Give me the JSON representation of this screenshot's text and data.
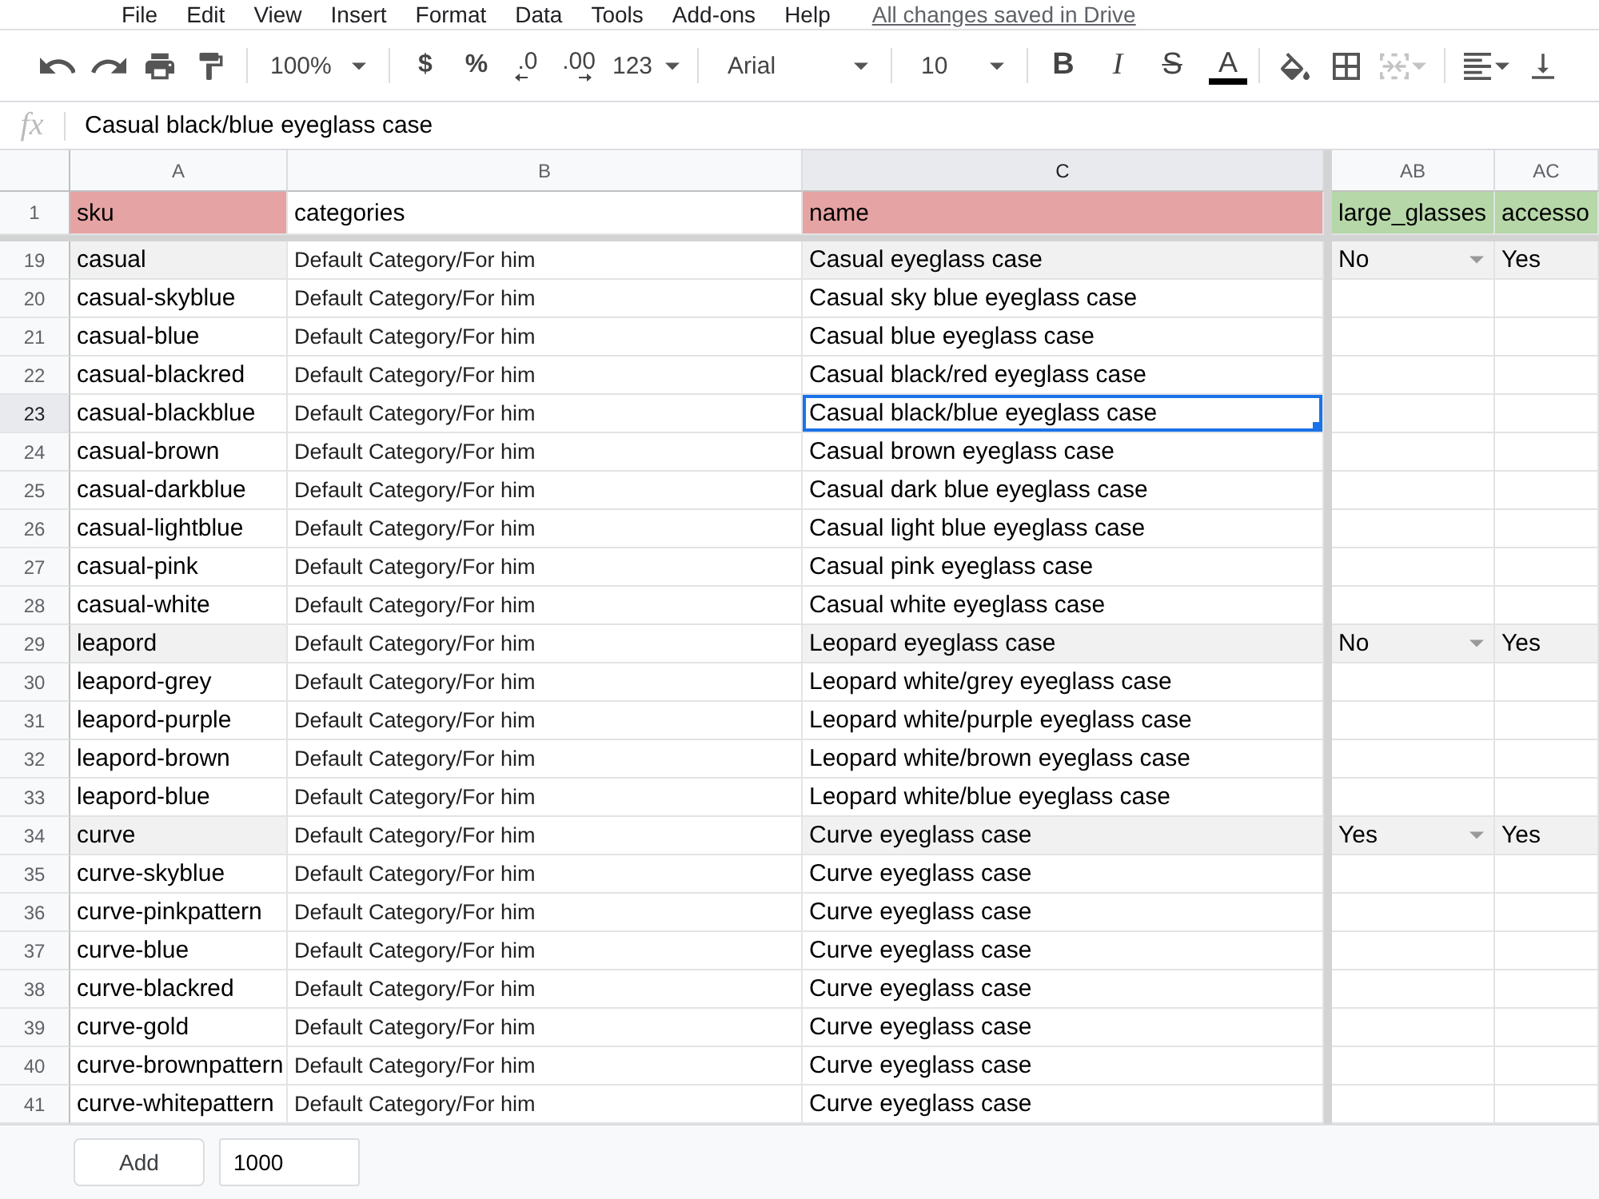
{
  "menu": {
    "items": [
      "File",
      "Edit",
      "View",
      "Insert",
      "Format",
      "Data",
      "Tools",
      "Add-ons",
      "Help"
    ],
    "save_status": "All changes saved in Drive"
  },
  "toolbar": {
    "zoom": "100%",
    "currency": "$",
    "percent": "%",
    "decrease_decimals": ".0",
    "increase_decimals": ".00",
    "number_format": "123",
    "font": "Arial",
    "font_size": "10",
    "bold": "B",
    "italic": "I",
    "strikethrough": "S",
    "text_color": "A",
    "merge_disabled": true
  },
  "formula_bar": {
    "label": "fx",
    "value": "Casual black/blue eyeglass case"
  },
  "columns": [
    {
      "letter": "A",
      "selected": false
    },
    {
      "letter": "B",
      "selected": false
    },
    {
      "letter": "C",
      "selected": true
    },
    {
      "letter": "AB",
      "selected": false
    },
    {
      "letter": "AC",
      "selected": false
    }
  ],
  "header_row": {
    "number": "1",
    "cells": [
      {
        "text": "sku",
        "color": "#e6a3a3"
      },
      {
        "text": "categories",
        "color": "#ffffff"
      },
      {
        "text": "name",
        "color": "#e6a3a3"
      },
      {
        "text": "large_glasses",
        "color": "#b6d7a8"
      },
      {
        "text": "accesso",
        "color": "#b6d7a8"
      }
    ]
  },
  "rows": [
    {
      "number": "19",
      "selected": false,
      "highlighted": true,
      "sku": "casual",
      "categories": "Default Category/For him",
      "name": "Casual eyeglass case",
      "large_glasses": "No",
      "column_ac": "Yes"
    },
    {
      "number": "20",
      "selected": false,
      "highlighted": false,
      "sku": "casual-skyblue",
      "categories": "Default Category/For him",
      "name": "Casual sky blue eyeglass case"
    },
    {
      "number": "21",
      "selected": false,
      "highlighted": false,
      "sku": "casual-blue",
      "categories": "Default Category/For him",
      "name": "Casual blue eyeglass case"
    },
    {
      "number": "22",
      "selected": false,
      "highlighted": false,
      "sku": "casual-blackred",
      "categories": "Default Category/For him",
      "name": "Casual black/red eyeglass case"
    },
    {
      "number": "23",
      "selected": true,
      "highlighted": false,
      "sku": "casual-blackblue",
      "categories": "Default Category/For him",
      "name": "Casual black/blue eyeglass case"
    },
    {
      "number": "24",
      "selected": false,
      "highlighted": false,
      "sku": "casual-brown",
      "categories": "Default Category/For him",
      "name": "Casual brown eyeglass case"
    },
    {
      "number": "25",
      "selected": false,
      "highlighted": false,
      "sku": "casual-darkblue",
      "categories": "Default Category/For him",
      "name": "Casual dark blue eyeglass case"
    },
    {
      "number": "26",
      "selected": false,
      "highlighted": false,
      "sku": "casual-lightblue",
      "categories": "Default Category/For him",
      "name": "Casual light blue eyeglass case"
    },
    {
      "number": "27",
      "selected": false,
      "highlighted": false,
      "sku": "casual-pink",
      "categories": "Default Category/For him",
      "name": "Casual pink eyeglass case"
    },
    {
      "number": "28",
      "selected": false,
      "highlighted": false,
      "sku": "casual-white",
      "categories": "Default Category/For him",
      "name": "Casual white eyeglass case"
    },
    {
      "number": "29",
      "selected": false,
      "highlighted": true,
      "sku": "leapord",
      "categories": "Default Category/For him",
      "name": "Leopard eyeglass case",
      "large_glasses": "No",
      "column_ac": "Yes"
    },
    {
      "number": "30",
      "selected": false,
      "highlighted": false,
      "sku": "leapord-grey",
      "categories": "Default Category/For him",
      "name": "Leopard white/grey eyeglass case"
    },
    {
      "number": "31",
      "selected": false,
      "highlighted": false,
      "sku": "leapord-purple",
      "categories": "Default Category/For him",
      "name": "Leopard white/purple eyeglass case"
    },
    {
      "number": "32",
      "selected": false,
      "highlighted": false,
      "sku": "leapord-brown",
      "categories": "Default Category/For him",
      "name": "Leopard white/brown eyeglass case"
    },
    {
      "number": "33",
      "selected": false,
      "highlighted": false,
      "sku": "leapord-blue",
      "categories": "Default Category/For him",
      "name": "Leopard white/blue eyeglass case"
    },
    {
      "number": "34",
      "selected": false,
      "highlighted": true,
      "sku": "curve",
      "categories": "Default Category/For him",
      "name": "Curve eyeglass case",
      "large_glasses": "Yes",
      "column_ac": "Yes"
    },
    {
      "number": "35",
      "selected": false,
      "highlighted": false,
      "sku": "curve-skyblue",
      "categories": "Default Category/For him",
      "name": "Curve eyeglass case"
    },
    {
      "number": "36",
      "selected": false,
      "highlighted": false,
      "sku": "curve-pinkpattern",
      "categories": "Default Category/For him",
      "name": "Curve eyeglass case"
    },
    {
      "number": "37",
      "selected": false,
      "highlighted": false,
      "sku": "curve-blue",
      "categories": "Default Category/For him",
      "name": "Curve eyeglass case"
    },
    {
      "number": "38",
      "selected": false,
      "highlighted": false,
      "sku": "curve-blackred",
      "categories": "Default Category/For him",
      "name": "Curve eyeglass case"
    },
    {
      "number": "39",
      "selected": false,
      "highlighted": false,
      "sku": "curve-gold",
      "categories": "Default Category/For him",
      "name": "Curve eyeglass case"
    },
    {
      "number": "40",
      "selected": false,
      "highlighted": false,
      "sku": "curve-brownpattern",
      "categories": "Default Category/For him",
      "name": "Curve eyeglass case"
    },
    {
      "number": "41",
      "selected": false,
      "highlighted": false,
      "sku": "curve-whitepattern",
      "categories": "Default Category/For him",
      "name": "Curve eyeglass case"
    }
  ],
  "footer": {
    "add_button": "Add",
    "row_count": "1000"
  }
}
